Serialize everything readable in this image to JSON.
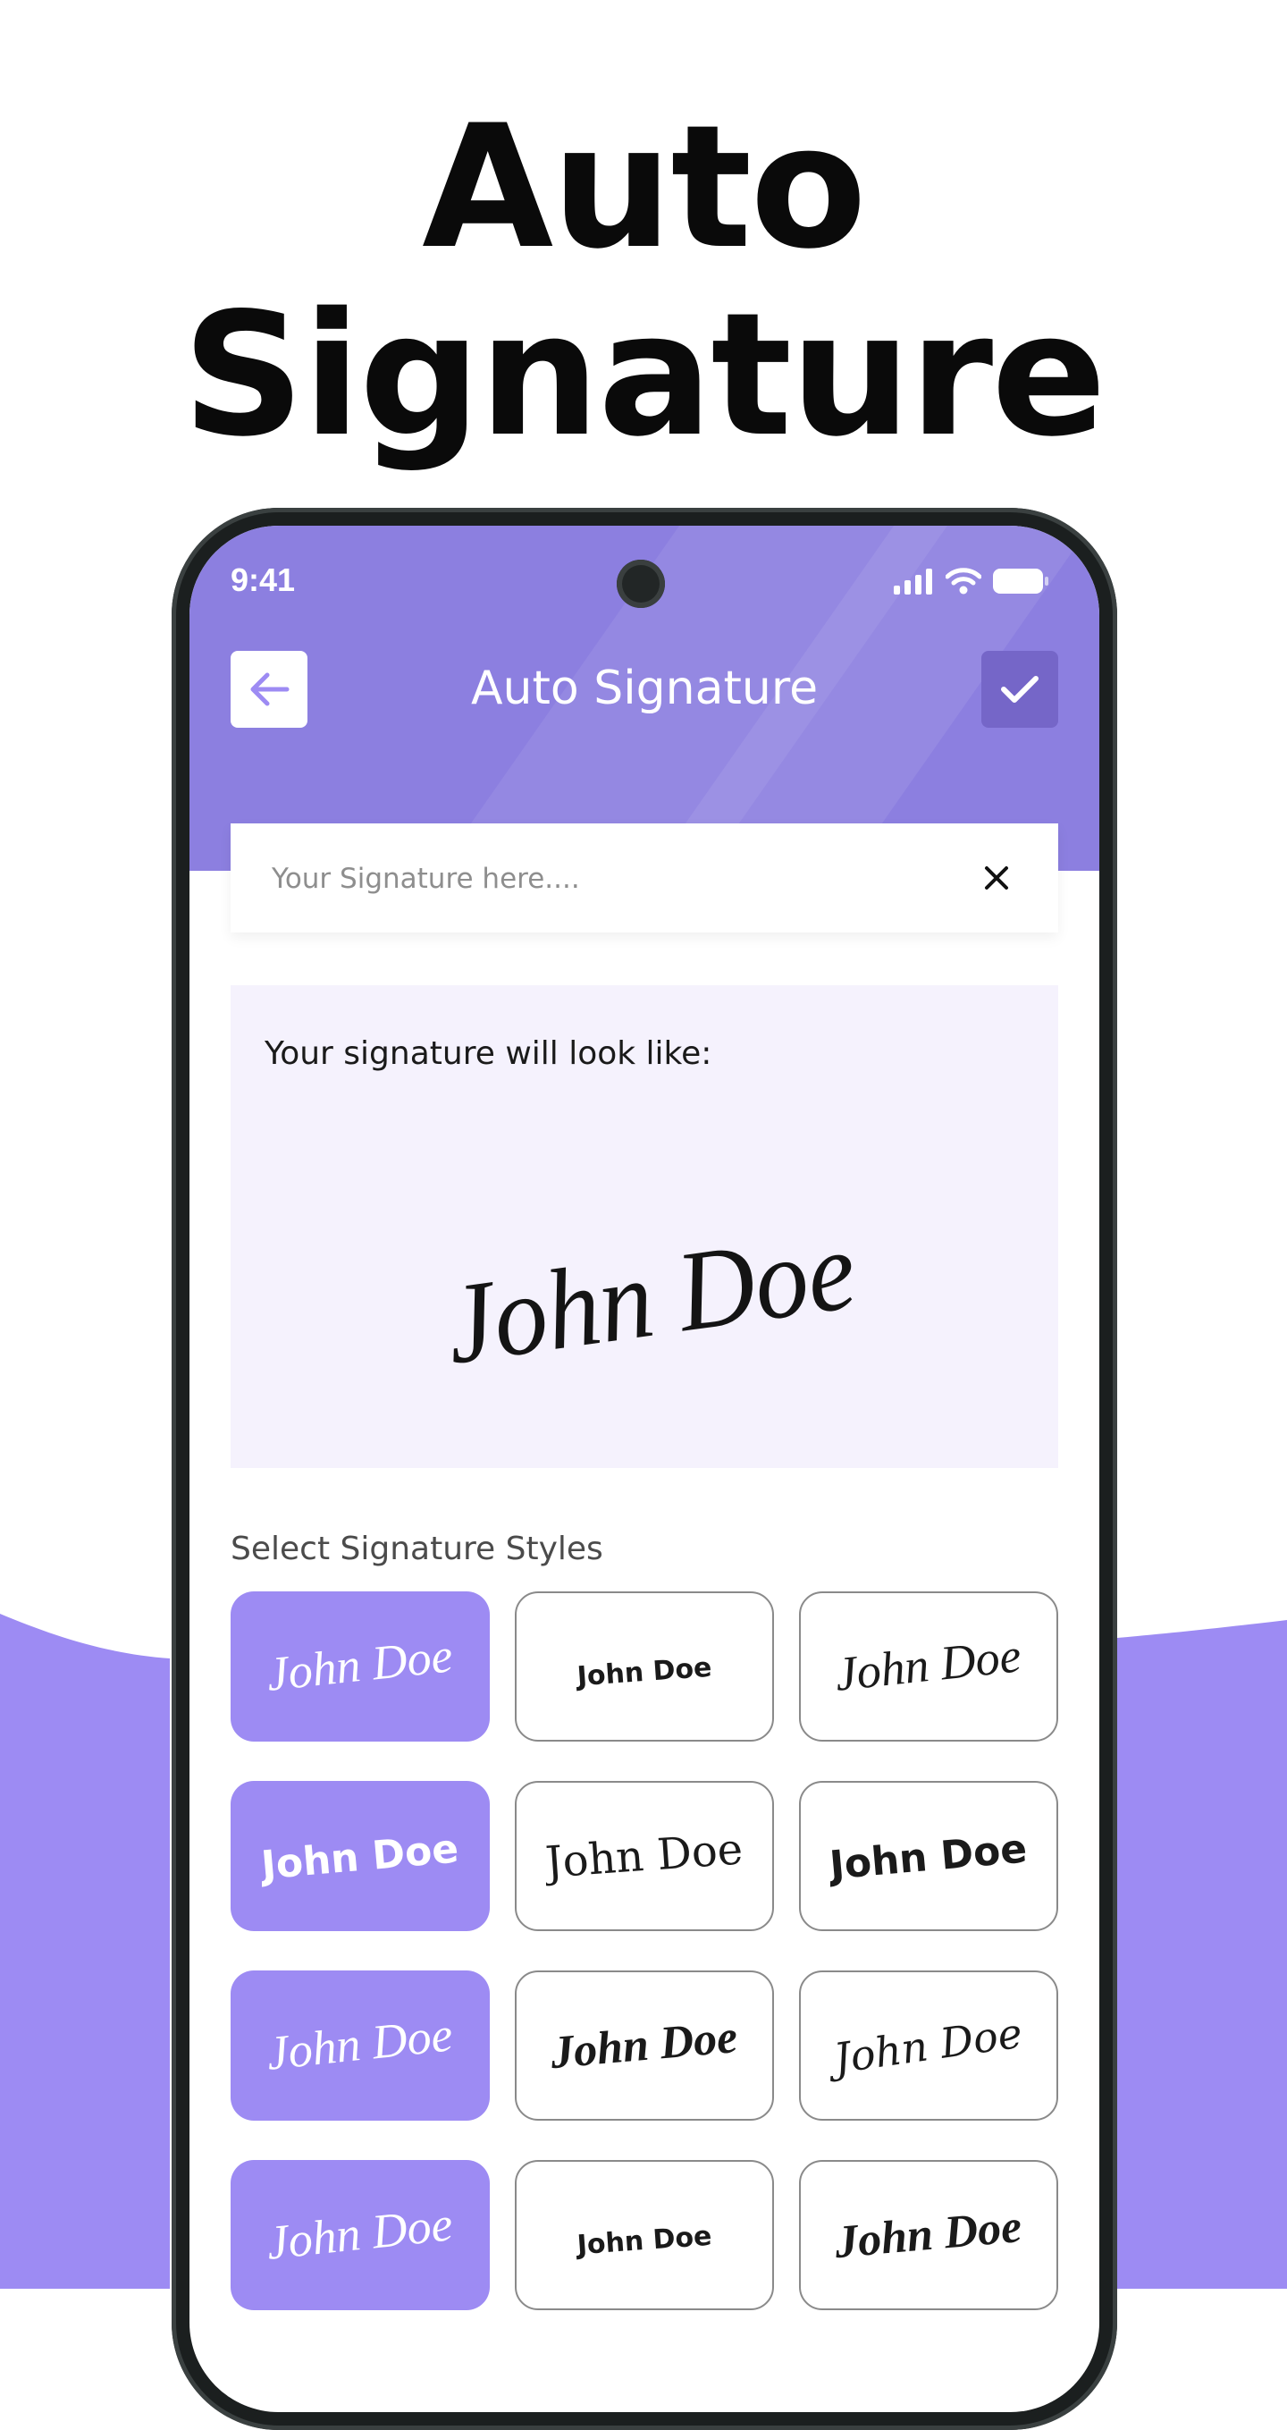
{
  "promo": {
    "title_line1": "Auto",
    "title_line2": "Signature"
  },
  "colors": {
    "accent": "#9d8bf3",
    "header": "#8c7fe0",
    "preview_bg": "#f5f2fd"
  },
  "status_bar": {
    "time": "9:41",
    "icons": [
      "signal-icon",
      "wifi-icon",
      "battery-icon"
    ]
  },
  "header": {
    "title": "Auto Signature",
    "back_icon": "arrow-left-icon",
    "done_icon": "check-icon"
  },
  "input": {
    "value": "",
    "placeholder": "Your Signature here....",
    "clear_icon": "close-icon"
  },
  "preview": {
    "label": "Your signature will look like:",
    "signature_text": "John Doe"
  },
  "styles": {
    "title": "Select Signature Styles",
    "tiles": [
      {
        "text": "John Doe",
        "style": "script-thin",
        "selected": true
      },
      {
        "text": "John Doe",
        "style": "print-small",
        "selected": false
      },
      {
        "text": "John Doe",
        "style": "script-thin",
        "selected": false
      },
      {
        "text": "John Doe",
        "style": "rounded-bold",
        "selected": true
      },
      {
        "text": "John Doe",
        "style": "serif",
        "selected": false
      },
      {
        "text": "John Doe",
        "style": "rounded-bold",
        "selected": false
      },
      {
        "text": "John Doe",
        "style": "script-thin",
        "selected": true
      },
      {
        "text": "John Doe",
        "style": "script-bold",
        "selected": false
      },
      {
        "text": "John Doe",
        "style": "script-fancy",
        "selected": false
      },
      {
        "text": "John Doe",
        "style": "script-thin",
        "selected": true
      },
      {
        "text": "John Doe",
        "style": "print-small",
        "selected": false
      },
      {
        "text": "John Doe",
        "style": "script-bold",
        "selected": false
      }
    ]
  }
}
